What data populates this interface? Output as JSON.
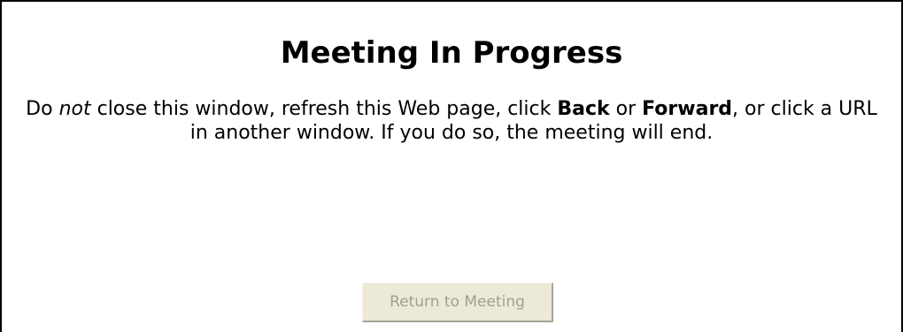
{
  "title": "Meeting In Progress",
  "message": {
    "part1": "Do ",
    "not": "not",
    "part2": " close this window, refresh this Web page, click ",
    "back": "Back",
    "part3": " or ",
    "forward": "Forward",
    "part4": ", or click a URL in another window. If you do so, the meeting will end."
  },
  "button": {
    "label": "Return to Meeting",
    "state": "disabled"
  }
}
